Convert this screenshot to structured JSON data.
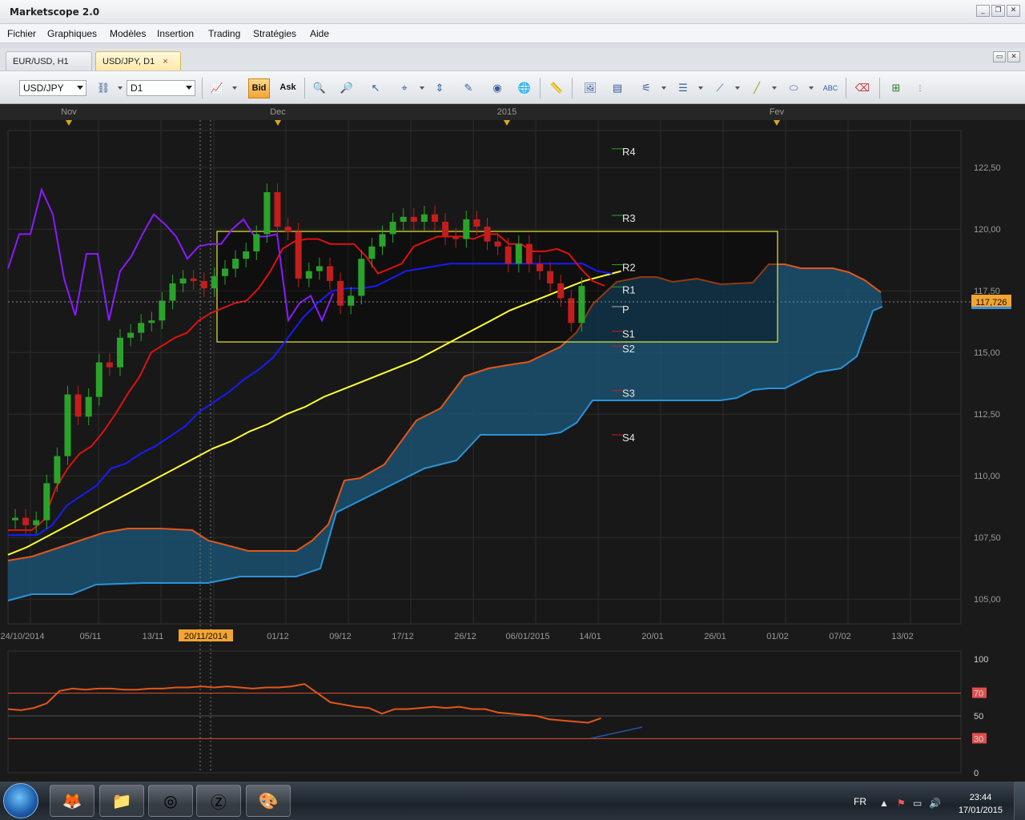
{
  "app": {
    "title": "Marketscope 2.0",
    "window_buttons": [
      "minimize-icon",
      "restore-icon",
      "close-icon"
    ]
  },
  "menu": {
    "items": [
      "Fichier",
      "Graphiques",
      "Modèles",
      "Insertion",
      "Trading",
      "Stratégies",
      "Aide"
    ]
  },
  "tabs": [
    {
      "label": "EUR/USD, H1",
      "active": false
    },
    {
      "label": "USD/JPY, D1",
      "active": true,
      "close": "×"
    }
  ],
  "toolbar": {
    "symbol": "USD/JPY",
    "period": "D1",
    "bid_label": "Bid",
    "ask_label": "Ask"
  },
  "colors": {
    "accent": "#f3a431",
    "price_tag": "#f3a431",
    "bull": "#2aa32a",
    "bear": "#c41d1d",
    "kijun": "#e01010",
    "tenkan": "#1a1aff",
    "sma": "#ffff33",
    "chikou": "#8a1aff",
    "cloud": "#1b5170"
  },
  "chart": {
    "months": [
      "Nov",
      "Dec",
      "2015",
      "Fev"
    ],
    "date_labels": [
      "24/10/2014",
      "05/11",
      "13/11",
      "20/11/2014",
      "01/12",
      "09/12",
      "17/12",
      "26/12",
      "06/01/2015",
      "14/01",
      "20/01",
      "26/01",
      "01/02",
      "07/02",
      "13/02"
    ],
    "highlighted_date": "20/11/2014",
    "price_ticks": [
      "122,50",
      "120,00",
      "117,50",
      "115,00",
      "112,50",
      "110,00",
      "107,50",
      "105,00"
    ],
    "current_price": "117,726",
    "pivot_labels": [
      "R4",
      "R3",
      "R2",
      "R1",
      "P",
      "S1",
      "S2",
      "S3",
      "S4"
    ]
  },
  "oscillator": {
    "ticks": [
      "100",
      "70",
      "50",
      "30",
      "0"
    ]
  },
  "taskbar": {
    "lang": "FR",
    "time": "23:44",
    "date": "17/01/2015"
  },
  "chart_data": {
    "type": "candlestick",
    "title": "USD/JPY, D1",
    "xlabel": "",
    "ylabel": "",
    "ylim": [
      104.0,
      124.0
    ],
    "x_axis": [
      "24/10/2014",
      "05/11",
      "13/11",
      "20/11/2014",
      "01/12",
      "09/12",
      "17/12",
      "26/12",
      "06/01/2015",
      "14/01",
      "20/01",
      "26/01",
      "01/02",
      "07/02",
      "13/02"
    ],
    "y_ticks": [
      105.0,
      107.5,
      110.0,
      112.5,
      115.0,
      117.5,
      120.0,
      122.5
    ],
    "last_price": 117.726,
    "pivots": {
      "R4": 123.0,
      "R3": 120.3,
      "R2": 118.3,
      "R1": 117.4,
      "P": 116.6,
      "S1": 115.6,
      "S2": 115.0,
      "S3": 113.2,
      "S4": 111.4
    },
    "series": [
      {
        "name": "Candles",
        "style": "ohlc",
        "open": [
          108.2,
          108.3,
          108.0,
          108.2,
          109.7,
          110.8,
          113.3,
          112.4,
          113.2,
          114.6,
          114.4,
          115.6,
          115.8,
          116.2,
          116.3,
          117.1,
          117.8,
          118.0,
          117.9,
          117.6,
          118.1,
          118.4,
          118.8,
          119.1,
          119.8,
          121.5,
          120.1,
          119.9,
          118.0,
          118.3,
          118.5,
          117.9,
          116.9,
          117.3,
          118.8,
          119.3,
          119.8,
          120.3,
          120.5,
          120.3,
          120.6,
          120.3,
          119.7,
          119.6,
          120.4,
          120.1,
          119.5,
          119.3,
          118.6,
          119.4,
          118.6,
          118.3,
          117.8,
          117.2,
          116.2
        ],
        "close": [
          108.3,
          108.0,
          108.2,
          109.7,
          110.8,
          113.3,
          112.4,
          113.2,
          114.6,
          114.4,
          115.6,
          115.8,
          116.2,
          116.3,
          117.1,
          117.8,
          118.0,
          117.9,
          117.6,
          118.1,
          118.4,
          118.8,
          119.1,
          119.8,
          121.5,
          120.1,
          119.9,
          118.0,
          118.3,
          118.5,
          117.9,
          116.9,
          117.3,
          118.8,
          119.3,
          119.8,
          120.3,
          120.5,
          120.3,
          120.6,
          120.3,
          119.7,
          119.6,
          120.4,
          120.1,
          119.5,
          119.3,
          118.6,
          119.4,
          118.6,
          118.3,
          117.8,
          117.2,
          116.2,
          117.7
        ]
      },
      {
        "name": "Kijun",
        "values": [
          107.8,
          107.8,
          107.8,
          108.2,
          109.5,
          110.3,
          110.9,
          111.2,
          111.8,
          112.5,
          113.3,
          114.0,
          115.0,
          115.3,
          115.6,
          115.8,
          116.3,
          116.6,
          116.8,
          117.0,
          117.1,
          117.6,
          118.3,
          119.2,
          119.5,
          119.6,
          119.6,
          119.4,
          119.4,
          119.4,
          118.9,
          118.2,
          118.4,
          118.6,
          119.3,
          119.5,
          119.7,
          119.7,
          119.7,
          119.6,
          119.8,
          119.8,
          119.4,
          119.4,
          119.1,
          119.1,
          119.2,
          119.0,
          118.4,
          117.9,
          117.7
        ]
      },
      {
        "name": "Tenkan",
        "values": [
          107.6,
          107.6,
          107.6,
          108.0,
          108.8,
          109.2,
          109.6,
          110.3,
          110.5,
          110.9,
          111.2,
          111.6,
          112.0,
          112.6,
          113.0,
          113.4,
          113.9,
          114.3,
          114.8,
          115.6,
          116.4,
          117.0,
          117.5,
          117.6,
          117.6,
          117.7,
          118.0,
          118.3,
          118.4,
          118.5,
          118.6,
          118.6,
          118.6,
          118.6,
          118.6,
          118.6,
          118.6,
          118.6,
          118.6,
          118.6,
          118.3,
          118.2
        ]
      },
      {
        "name": "SMA",
        "values": [
          106.8,
          107.1,
          107.5,
          107.9,
          108.3,
          108.7,
          109.1,
          109.5,
          109.9,
          110.3,
          110.7,
          111.1,
          111.4,
          111.8,
          112.1,
          112.5,
          112.8,
          113.2,
          113.5,
          113.8,
          114.1,
          114.4,
          114.7,
          115.1,
          115.5,
          115.9,
          116.3,
          116.7,
          117.0,
          117.3,
          117.6,
          117.9,
          118.1,
          118.3
        ]
      },
      {
        "name": "Chikou",
        "values": [
          118.4,
          119.8,
          119.8,
          121.6,
          120.6,
          118.0,
          116.5,
          119.0,
          119.0,
          116.3,
          118.3,
          118.9,
          119.8,
          120.6,
          120.2,
          119.7,
          118.8,
          119.3,
          119.4,
          119.4,
          120.0,
          120.4,
          119.7,
          119.7,
          119.8,
          116.3,
          117.0,
          117.3,
          116.3,
          117.4
        ]
      }
    ],
    "oscillator": {
      "name": "RSI",
      "ylim": [
        0,
        100
      ],
      "levels": [
        30,
        50,
        70
      ],
      "values": [
        56,
        55,
        57,
        61,
        72,
        74,
        73,
        74,
        74,
        73,
        73,
        74,
        74,
        75,
        75,
        76,
        75,
        76,
        75,
        74,
        75,
        75,
        76,
        78,
        70,
        62,
        60,
        58,
        57,
        52,
        56,
        56,
        57,
        58,
        57,
        58,
        56,
        56,
        53,
        52,
        51,
        50,
        47,
        46,
        45,
        44,
        48
      ]
    }
  }
}
